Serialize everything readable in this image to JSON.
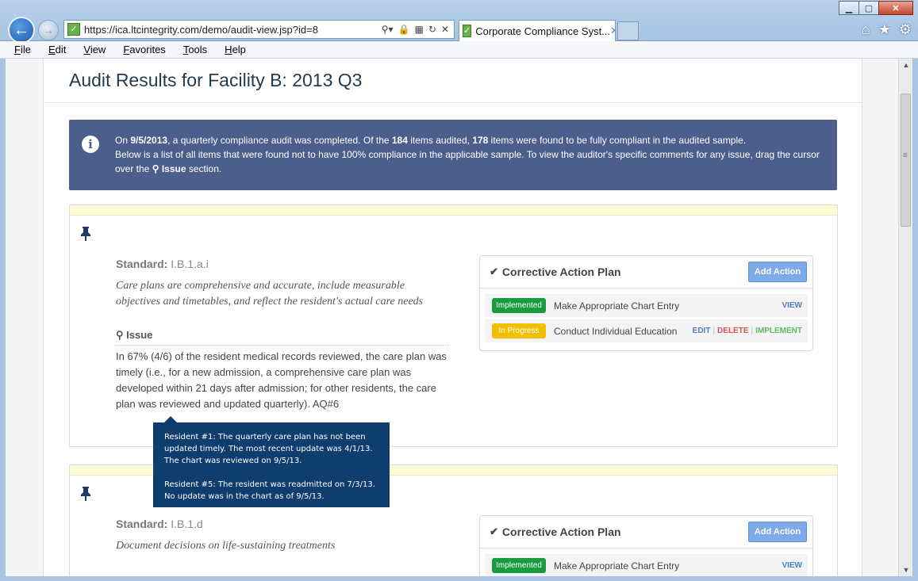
{
  "browser": {
    "url": "https://ica.ltcintegrity.com/demo/audit-view.jsp?id=8",
    "tab_title": "Corporate Compliance Syst...",
    "menu": [
      "File",
      "Edit",
      "View",
      "Favorites",
      "Tools",
      "Help"
    ]
  },
  "page": {
    "title": "Audit Results for Facility B: 2013 Q3",
    "banner": {
      "line1_pre": "On ",
      "date": "9/5/2013",
      "line1_mid": ", a quarterly compliance audit was completed. Of the ",
      "audited": "184",
      "line1_mid2": " items audited, ",
      "compliant": "178",
      "line1_post": " items were found to be fully compliant in the audited sample.",
      "line2": "Below is a list of all items that were found not to have 100% compliance in the applicable sample. To view the auditor's specific comments for any issue, drag the cursor over the",
      "issue_word": "Issue",
      "line2_post": " section."
    }
  },
  "cards": [
    {
      "standard_label": "Standard:",
      "standard_code": "I.B.1.a.i",
      "description": "Care plans are comprehensive and accurate, include measurable objectives and timetables, and reflect the resident's actual care needs",
      "issue_label": "Issue",
      "issue_text": "In 67% (4/6) of the resident medical records reviewed, the care plan was timely (i.e., for a new admission, a comprehensive care plan was developed within 21 days after admission; for other residents, the care plan was reviewed and updated quarterly). AQ#6",
      "cap_title": "Corrective Action Plan",
      "add_action": "Add Action",
      "rows": [
        {
          "status": "Implemented",
          "action": "Make Appropriate Chart Entry",
          "view": "VIEW"
        },
        {
          "status": "In Progress",
          "action": "Conduct Individual Education",
          "edit": "EDIT",
          "delete": "DELETE",
          "implement": "IMPLEMENT"
        }
      ]
    },
    {
      "standard_label": "Standard:",
      "standard_code": "I.B.1.d",
      "description": "Document decisions on life-sustaining treatments",
      "cap_title": "Corrective Action Plan",
      "add_action": "Add Action",
      "rows": [
        {
          "status": "Implemented",
          "action": "Make Appropriate Chart Entry",
          "view": "VIEW"
        }
      ]
    }
  ],
  "tooltip": {
    "p1": "Resident #1: The quarterly care plan has not been updated timely. The most recent update was 4/1/13. The chart was reviewed on 9/5/13.",
    "p2": "Resident #5: The resident was readmitted on 7/3/13. No update was in the chart as of 9/5/13."
  },
  "colors": {
    "banner": "#4b5e8c",
    "implemented": "#199b3f",
    "in_progress": "#f0c000",
    "tooltip": "#0e3d6e",
    "add_button": "#7faae8"
  }
}
